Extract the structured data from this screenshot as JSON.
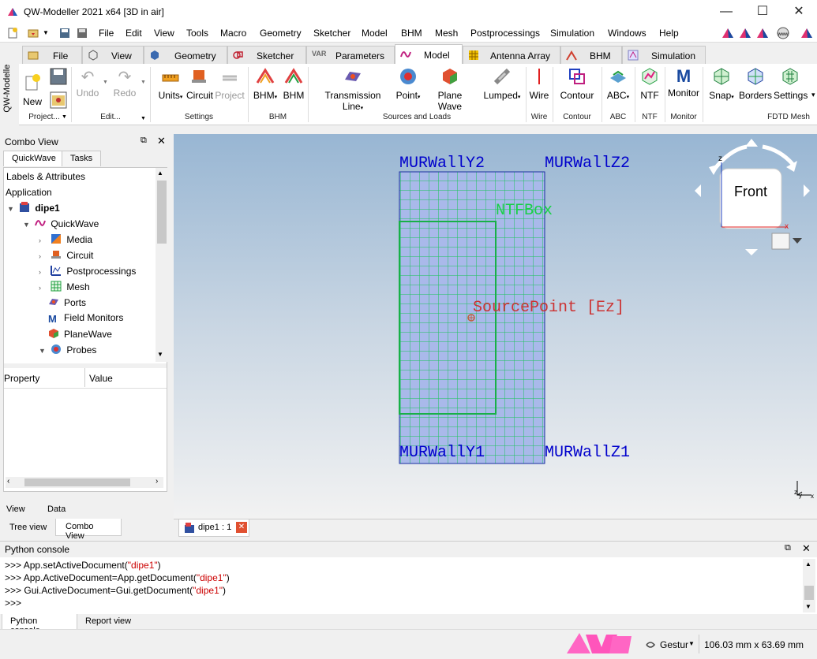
{
  "window": {
    "title": "QW-Modeller 2021 x64 [3D in air]",
    "minimize": "—",
    "maximize": "☐",
    "close": "✕"
  },
  "menu": [
    "File",
    "Edit",
    "View",
    "Tools",
    "Macro",
    "Geometry",
    "Sketcher",
    "Model",
    "BHM",
    "Mesh",
    "Postprocessings",
    "Simulation",
    "Windows",
    "Help"
  ],
  "side_strip_label": "QW-Modeller",
  "workbench_tabs": [
    "File",
    "View",
    "Geometry",
    "Sketcher",
    "Parameters",
    "Model",
    "Antenna Array",
    "BHM",
    "Simulation"
  ],
  "active_workbench_tab": "Model",
  "parameters_tab_icon_text": "VAR",
  "ribbon": {
    "buttons": {
      "new": "New",
      "undo": "Undo",
      "redo": "Redo",
      "units": "Units",
      "circuit": "Circuit",
      "project": "Project",
      "bhm1": "BHM",
      "bhm2": "BHM",
      "transmission_line": "Transmission Line",
      "point": "Point",
      "plane_wave": "Plane Wave",
      "lumped": "Lumped",
      "wire": "Wire",
      "contour": "Contour",
      "abc": "ABC",
      "ntf": "NTF",
      "monitor": "Monitor",
      "snap": "Snap",
      "borders": "Borders",
      "settings": "Settings"
    },
    "groups": {
      "project": "Project...",
      "edit": "Edit...",
      "settings": "Settings",
      "bhm": "BHM",
      "sources": "Sources and Loads",
      "wire": "Wire",
      "contour": "Contour",
      "abc": "ABC",
      "ntf": "NTF",
      "monitor": "Monitor",
      "fdtd": "FDTD Mesh"
    }
  },
  "combo_view": {
    "title": "Combo View",
    "tabs": [
      "QuickWave",
      "Tasks"
    ],
    "tree": {
      "header": "Labels & Attributes",
      "application": "Application",
      "document": "dipe1",
      "quickwave": "QuickWave",
      "children": [
        "Media",
        "Circuit",
        "Postprocessings",
        "Mesh",
        "Ports",
        "Field Monitors",
        "PlaneWave",
        "Probes"
      ]
    },
    "property_header": "Property",
    "value_header": "Value",
    "subtabs": [
      "View",
      "Data"
    ]
  },
  "bottom_left_tabs": [
    "Tree view",
    "Combo View"
  ],
  "viewport": {
    "labels": {
      "wall_y2": "MURWallY2",
      "wall_z2": "MURWallZ2",
      "ntfbox": "NTFBox",
      "source": "SourcePoint [Ez]",
      "wall_y1": "MURWallY1",
      "wall_z1": "MURWallZ1"
    },
    "navicube_face": "Front",
    "axis_z": "z",
    "axis_x": "x",
    "axis_y": "y"
  },
  "document_tab": "dipe1 : 1",
  "console": {
    "title": "Python console",
    "lines": [
      [
        ">>> ",
        "App.setActiveDocument(",
        "\"dipe1\"",
        ")"
      ],
      [
        ">>> ",
        "App.ActiveDocument=App.getDocument(",
        "\"dipe1\"",
        ")"
      ],
      [
        ">>> ",
        "Gui.ActiveDocument=Gui.getDocument(",
        "\"dipe1\"",
        ")"
      ],
      [
        ">>> ",
        "",
        "",
        ""
      ]
    ],
    "tabs": [
      "Python console",
      "Report view"
    ]
  },
  "status": {
    "navigation": "Gestur",
    "dimensions": "106.03 mm x 63.69 mm"
  },
  "colors": {
    "accent_blue": "#0000cc",
    "mesh_green": "#00c850",
    "source_red": "#cc3333",
    "box_fill": "#a9b9ea"
  }
}
